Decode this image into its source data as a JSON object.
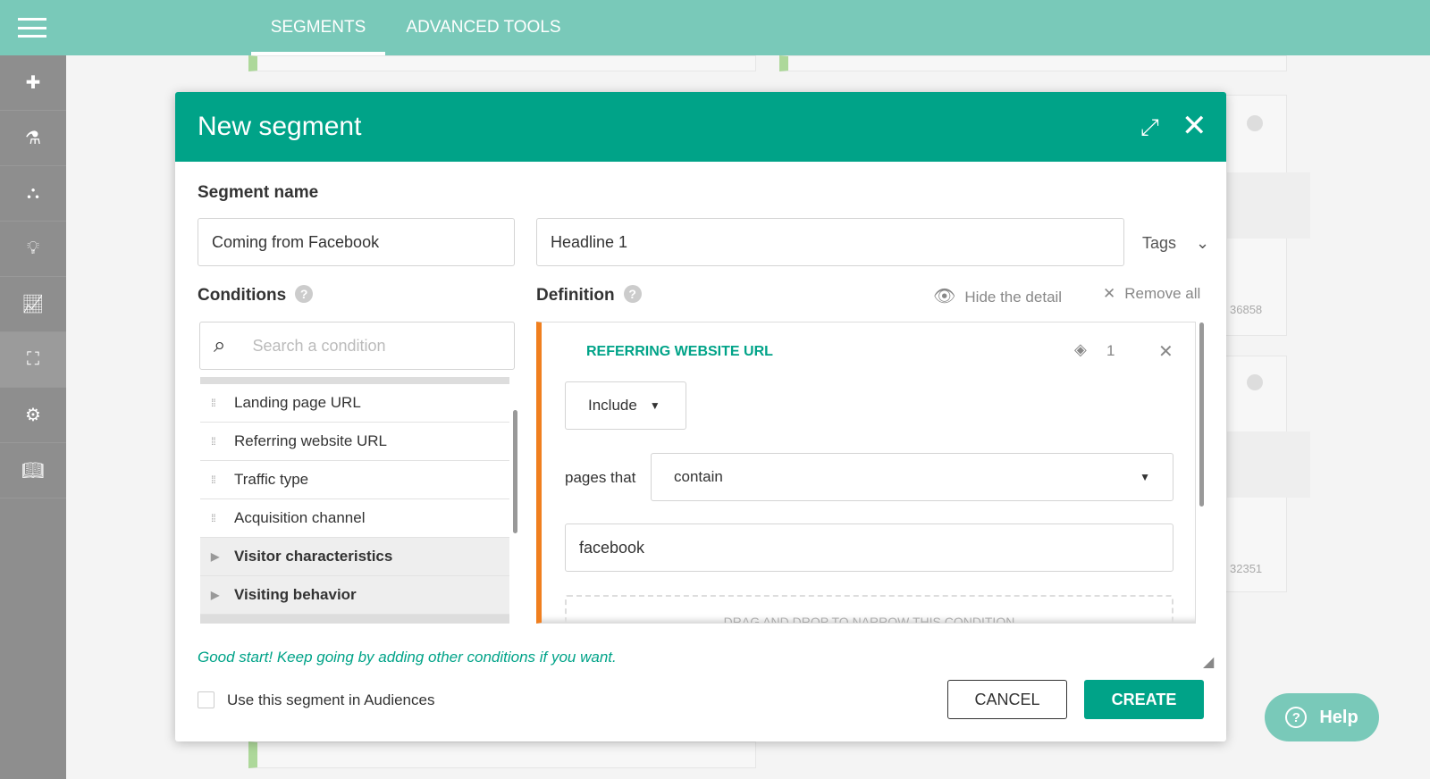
{
  "topbar": {
    "tabs": [
      {
        "label": "SEGMENTS",
        "active": true
      },
      {
        "label": "ADVANCED TOOLS"
      }
    ]
  },
  "sidebar": {
    "items": [
      "plus-icon",
      "test-tube-icon",
      "org-chart-icon",
      "lightbulb-icon",
      "chart-icon",
      "add-frame-icon",
      "gear-icon",
      "book-icon"
    ],
    "active": 5
  },
  "background": {
    "values": [
      "36858",
      "32351"
    ]
  },
  "modal": {
    "title": "New segment",
    "segment_name_label": "Segment name",
    "segment_name_value": "Coming from Facebook",
    "headline_value": "Headline 1",
    "tags_label": "Tags",
    "conditions_label": "Conditions",
    "search_placeholder": "Search a condition",
    "conditions": [
      "Landing page URL",
      "Referring website URL",
      "Traffic type",
      "Acquisition channel"
    ],
    "groups": [
      "Visitor characteristics",
      "Visiting behavior"
    ],
    "definition_label": "Definition",
    "hide_detail": "Hide the detail",
    "remove_all": "Remove all",
    "condition": {
      "title": "REFERRING WEBSITE URL",
      "count": "1",
      "include": "Include",
      "pages_that": "pages that",
      "operator": "contain",
      "value": "facebook",
      "dropzone": "DRAG AND DROP TO NARROW THIS CONDITION"
    },
    "hint": "Good start! Keep going by adding other conditions if you want.",
    "audiences_label": "Use this segment in Audiences",
    "audiences_checked": false,
    "cancel": "CANCEL",
    "create": "CREATE"
  },
  "help": {
    "label": "Help"
  },
  "colors": {
    "topbar": "#79c9b9",
    "modal_header": "#00a388",
    "accent_orange": "#f07f1f",
    "sidebar": "#8e8e8e"
  }
}
